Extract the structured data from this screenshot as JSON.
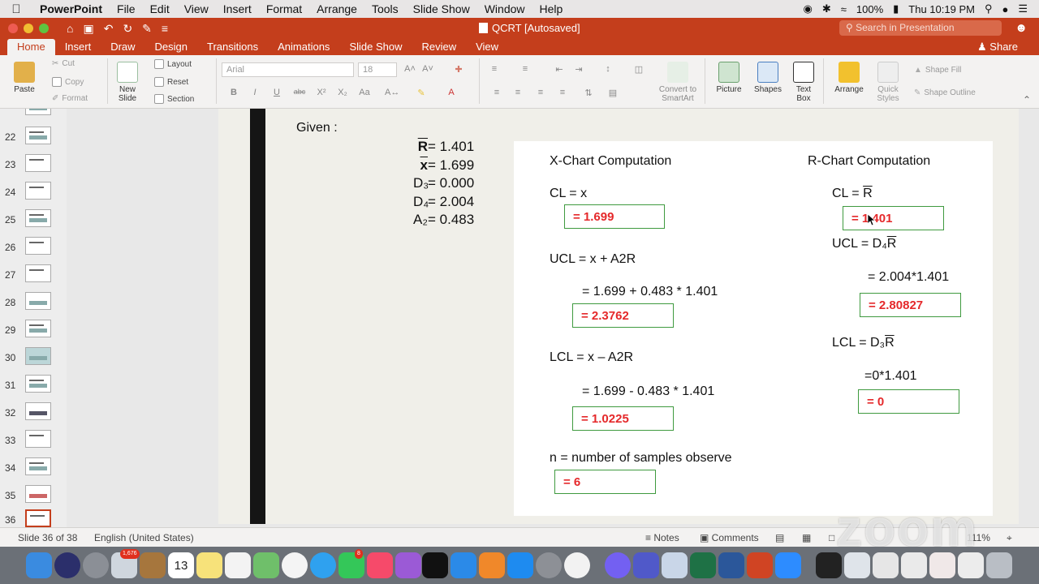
{
  "menubar": {
    "items": [
      "PowerPoint",
      "File",
      "Edit",
      "View",
      "Insert",
      "Format",
      "Arrange",
      "Tools",
      "Slide Show",
      "Window",
      "Help"
    ],
    "battery": "100%",
    "clock": "Thu 10:19 PM"
  },
  "window": {
    "title": "QCRT [Autosaved]",
    "search_placeholder": "Search in Presentation",
    "share_label": "Share"
  },
  "tabs": [
    "Home",
    "Insert",
    "Draw",
    "Design",
    "Transitions",
    "Animations",
    "Slide Show",
    "Review",
    "View"
  ],
  "ribbon": {
    "paste": "Paste",
    "cut": "Cut",
    "copy": "Copy",
    "format": "Format",
    "new_slide": "New Slide",
    "layout": "Layout",
    "reset": "Reset",
    "section": "Section",
    "font_name": "Arial",
    "font_size": "18",
    "convert_smartart": "Convert to SmartArt",
    "picture": "Picture",
    "shapes": "Shapes",
    "text_box": "Text Box",
    "arrange": "Arrange",
    "quick_styles": "Quick Styles",
    "shape_fill": "Shape Fill",
    "shape_outline": "Shape Outline"
  },
  "thumbnails": [
    "22",
    "23",
    "24",
    "25",
    "26",
    "27",
    "28",
    "29",
    "30",
    "31",
    "32",
    "33",
    "34",
    "35",
    "36"
  ],
  "slide": {
    "given_label": "Given :",
    "params": [
      {
        "sym": "R",
        "value": "= 1.401"
      },
      {
        "sym": "x",
        "value": "= 1.699"
      },
      {
        "sym": "D₃",
        "value": "= 0.000"
      },
      {
        "sym": "D₄",
        "value": "= 2.004"
      },
      {
        "sym": "A₂",
        "value": "= 0.483"
      }
    ],
    "x_chart": {
      "title": "X-Chart Computation",
      "cl_formula": "CL = x",
      "cl_result": "= 1.699",
      "ucl_formula": "UCL = x + A2R",
      "ucl_calc": "= 1.699 + 0.483 * 1.401",
      "ucl_result": "= 2.3762",
      "lcl_formula": "LCL = x – A2R",
      "lcl_calc": "= 1.699 - 0.483 * 1.401",
      "lcl_result": "= 1.0225",
      "n_label": "n = number of samples observe",
      "n_result": "= 6"
    },
    "r_chart": {
      "title": "R-Chart Computation",
      "cl_formula_prefix": "CL = ",
      "cl_formula_sym": "R",
      "cl_result": "= 1.401",
      "ucl_prefix": "UCL = D₄",
      "ucl_sym": "R",
      "ucl_calc": "= 2.004*1.401",
      "ucl_result": "= 2.80827",
      "lcl_prefix": "LCL = D₃",
      "lcl_sym": "R",
      "lcl_calc": "=0*1.401",
      "lcl_result": "= 0"
    }
  },
  "statusbar": {
    "slide_count": "Slide 36 of 38",
    "language": "English (United States)",
    "notes": "Notes",
    "comments": "Comments",
    "zoom": "111%"
  },
  "watermark": "zoom",
  "dock": {
    "badges": [
      "1,676",
      "8"
    ],
    "calendar_day": "13"
  }
}
